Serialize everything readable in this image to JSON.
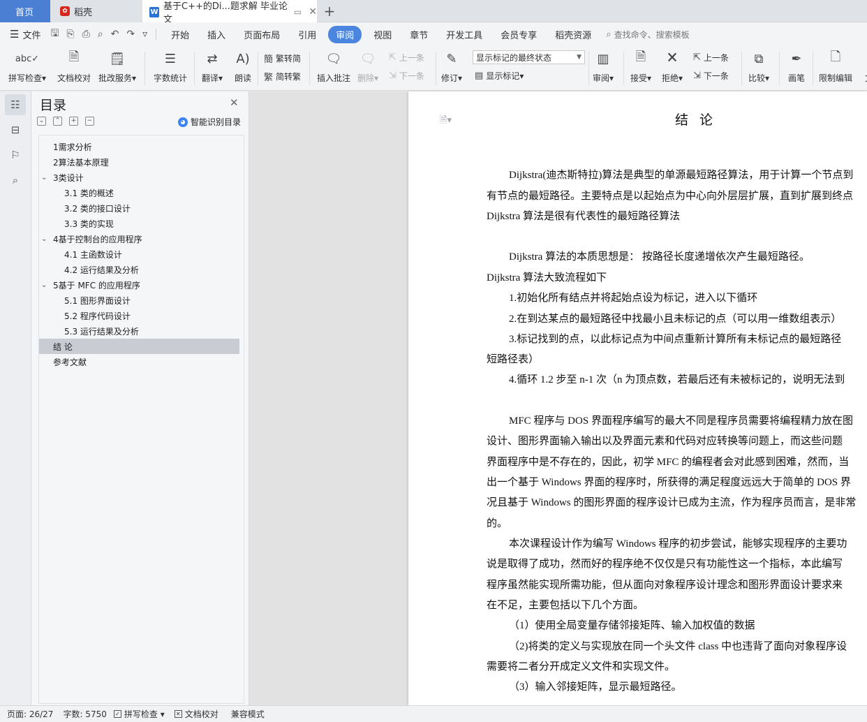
{
  "tabs": {
    "home": "首页",
    "straw": "稻壳",
    "doc": "基于C++的Di...题求解 毕业论文"
  },
  "menu": {
    "file": "文件",
    "items": [
      "开始",
      "插入",
      "页面布局",
      "引用",
      "审阅",
      "视图",
      "章节",
      "开发工具",
      "会员专享",
      "稻壳资源"
    ],
    "search": "查找命令、搜索模板"
  },
  "ribbon": {
    "spell": "拼写检查",
    "proof": "文档校对",
    "annotate_svc": "批改服务",
    "wordcount": "字数统计",
    "translate": "翻译",
    "read": "朗读",
    "trad": "繁转简",
    "simp": "简转繁",
    "insert_comment": "插入批注",
    "delete": "删除",
    "prev": "上一条",
    "next": "下一条",
    "revise": "修订",
    "review_mode": "显示标记的最终状态",
    "show_marks": "显示标记",
    "review": "审阅",
    "accept": "接受",
    "reject": "拒绝",
    "prev2": "上一条",
    "next2": "下一条",
    "compare": "比较",
    "pen": "画笔",
    "restrict": "限制编辑",
    "more": "文"
  },
  "toc": {
    "title": "目录",
    "smart": "智能识别目录",
    "items": [
      "1需求分析",
      "2算法基本原理",
      "3类设计",
      "3.1  类的概述",
      "3.2  类的接口设计",
      "3.3  类的实现",
      "4基于控制台的应用程序",
      "4.1  主函数设计",
      "4.2  运行结果及分析",
      "5基于 MFC 的应用程序",
      "5.1  图形界面设计",
      "5.2  程序代码设计",
      "5.3  运行结果及分析",
      "结    论",
      "参考文献"
    ]
  },
  "doc": {
    "title": "结论",
    "lines": [
      "Dijkstra(迪杰斯特拉)算法是典型的单源最短路径算法，用于计算一个节点到",
      "有节点的最短路径。主要特点是以起始点为中心向外层层扩展，直到扩展到终点",
      "Dijkstra 算法是很有代表性的最短路径算法",
      "Dijkstra 算法的本质思想是：  按路径长度递增依次产生最短路径。",
      "Dijkstra 算法大致流程如下",
      "1.初始化所有结点并将起始点设为标记，进入以下循环",
      "2.在到达某点的最短路径中找最小且未标记的点（可以用一维数组表示）",
      "3.标记找到的点，以此标记点为中间点重新计算所有未标记点的最短路径",
      "短路径表）",
      "4.循环 1.2 步至 n-1 次（n 为顶点数，若最后还有未被标记的，说明无法到",
      "MFC 程序与 DOS 界面程序编写的最大不同是程序员需要将编程精力放在图",
      "设计、图形界面输入输出以及界面元素和代码对应转换等问题上，而这些问题",
      "界面程序中是不存在的，因此，初学 MFC 的编程者会对此感到困难，然而，当",
      "出一个基于 Windows 界面的程序时，所获得的满足程度远远大于简单的 DOS 界",
      "况且基于 Windows 的图形界面的程序设计已成为主流，作为程序员而言，是非常",
      "的。",
      "本次课程设计作为编写 Windows 程序的初步尝试，能够实现程序的主要功",
      "说是取得了成功，然而好的程序绝不仅仅是只有功能性这一个指标，本此编写",
      "程序虽然能实现所需功能，但从面向对象程序设计理念和图形界面设计要求来",
      "在不足，主要包括以下几个方面。",
      "（1）使用全局变量存储邻接矩阵、输入加权值的数据",
      "（2)将类的定义与实现放在同一个头文件 class 中也违背了面向对象程序设",
      "需要将二者分开成定义文件和实现文件。",
      "（3）输入邻接矩阵，显示最短路径。"
    ]
  },
  "status": {
    "page": "页面: 26/27",
    "words": "字数: 5750",
    "spell": "拼写检查",
    "proof": "文档校对",
    "compat": "兼容模式"
  }
}
